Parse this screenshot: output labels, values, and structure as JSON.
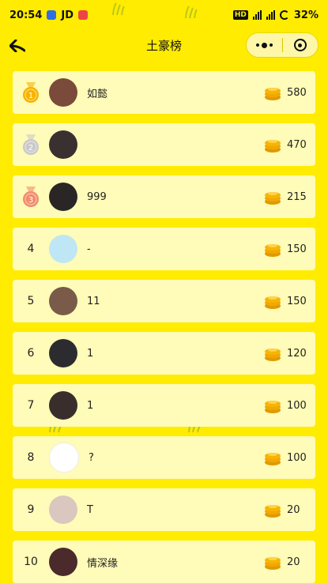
{
  "status": {
    "time": "20:54",
    "app_badge": "JD",
    "battery": "32%"
  },
  "nav": {
    "title": "土豪榜"
  },
  "colors": {
    "background": "#ffec00",
    "card": "#fffbb8",
    "gold_medal": "#f6b300",
    "silver_medal": "#c9c9c9",
    "bronze_medal": "#f28c6b",
    "coin": "#f7b500"
  },
  "icons": {
    "back": "arrow-left-icon",
    "more": "more-dots-icon",
    "close": "target-icon",
    "coin": "coin-stack-icon",
    "medal": "medal-icon"
  },
  "leaderboard": [
    {
      "rank": "1",
      "name": "如懿",
      "score": "580",
      "medal": "gold"
    },
    {
      "rank": "2",
      "name": "",
      "score": "470",
      "medal": "silver"
    },
    {
      "rank": "3",
      "name": "999",
      "score": "215",
      "medal": "bronze"
    },
    {
      "rank": "4",
      "name": "-",
      "score": "150",
      "medal": ""
    },
    {
      "rank": "5",
      "name": "11",
      "score": "150",
      "medal": ""
    },
    {
      "rank": "6",
      "name": "1",
      "score": "120",
      "medal": ""
    },
    {
      "rank": "7",
      "name": "1",
      "score": "100",
      "medal": ""
    },
    {
      "rank": "8",
      "name": "?",
      "score": "100",
      "medal": ""
    },
    {
      "rank": "9",
      "name": "T",
      "score": "20",
      "medal": ""
    },
    {
      "rank": "10",
      "name": "情深缘",
      "score": "20",
      "medal": ""
    }
  ]
}
